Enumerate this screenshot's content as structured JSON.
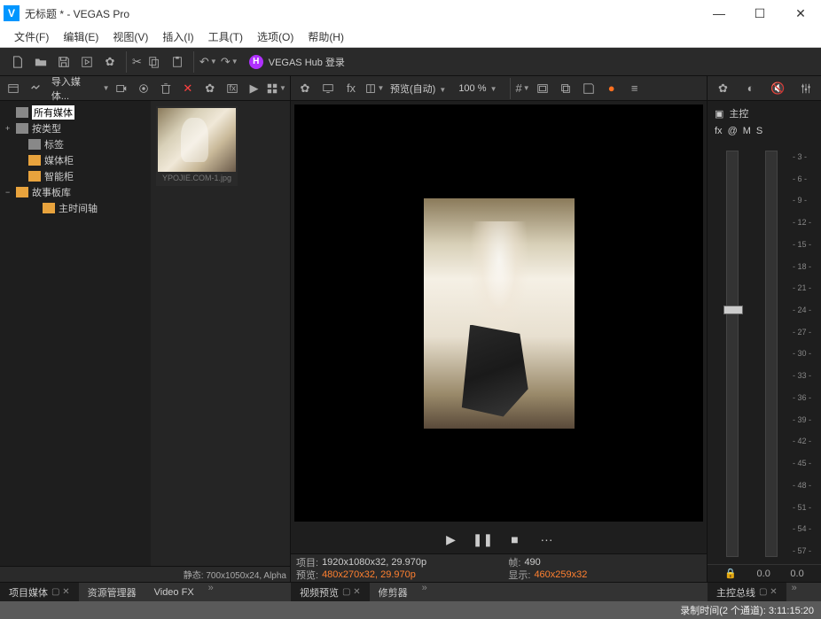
{
  "title": "无标题 * - VEGAS Pro",
  "menu": [
    "文件(F)",
    "编辑(E)",
    "视图(V)",
    "插入(I)",
    "工具(T)",
    "选项(O)",
    "帮助(H)"
  ],
  "hub": "VEGAS Hub 登录",
  "importLabel": "导入媒体...",
  "tree": [
    {
      "depth": 0,
      "toggle": "",
      "icon": "dark",
      "label": "所有媒体",
      "sel": true
    },
    {
      "depth": 0,
      "toggle": "+",
      "icon": "dark",
      "label": "按类型"
    },
    {
      "depth": 1,
      "toggle": "",
      "icon": "dark",
      "label": "标签"
    },
    {
      "depth": 1,
      "toggle": "",
      "icon": "",
      "label": "媒体柜"
    },
    {
      "depth": 1,
      "toggle": "",
      "icon": "",
      "label": "智能柜"
    },
    {
      "depth": 0,
      "toggle": "−",
      "icon": "",
      "label": "故事板库"
    },
    {
      "depth": 2,
      "toggle": "",
      "icon": "",
      "label": "主时间轴"
    }
  ],
  "thumbLabel": "YPOJIE.COM-1.jpg",
  "mediaStatus": "静态: 700x1050x24, Alpha",
  "previewMode": "预览(自动)",
  "zoom": "100 %",
  "playback": {
    "play": "▶",
    "pause": "❚❚",
    "stop": "■",
    "more": "···"
  },
  "previewStatus": {
    "proj_l": "项目:",
    "proj_v": "1920x1080x32, 29.970p",
    "prev_l": "预览:",
    "prev_v": "480x270x32, 29.970p",
    "frame_l": "帧:",
    "frame_v": "490",
    "disp_l": "显示:",
    "disp_v": "460x259x32"
  },
  "master": {
    "title": "主控",
    "fx": "fx",
    "at": "@",
    "m": "M",
    "s": "S"
  },
  "scale": [
    "3",
    "6",
    "9",
    "12",
    "15",
    "18",
    "21",
    "24",
    "27",
    "30",
    "33",
    "36",
    "39",
    "42",
    "45",
    "48",
    "51",
    "54",
    "57"
  ],
  "meterVals": {
    "l": "0.0",
    "r": "0.0"
  },
  "tabs": {
    "left": [
      {
        "l": "项目媒体",
        "a": true,
        "c": true
      },
      {
        "l": "资源管理器",
        "a": false,
        "c": false
      },
      {
        "l": "Video FX",
        "a": false,
        "c": false
      }
    ],
    "center": [
      {
        "l": "视频预览",
        "a": true,
        "c": true
      },
      {
        "l": "修剪器",
        "a": false,
        "c": false
      }
    ],
    "right": [
      {
        "l": "主控总线",
        "a": true,
        "c": true
      }
    ]
  },
  "status": "录制时间(2 个通道): 3:11:15:20"
}
